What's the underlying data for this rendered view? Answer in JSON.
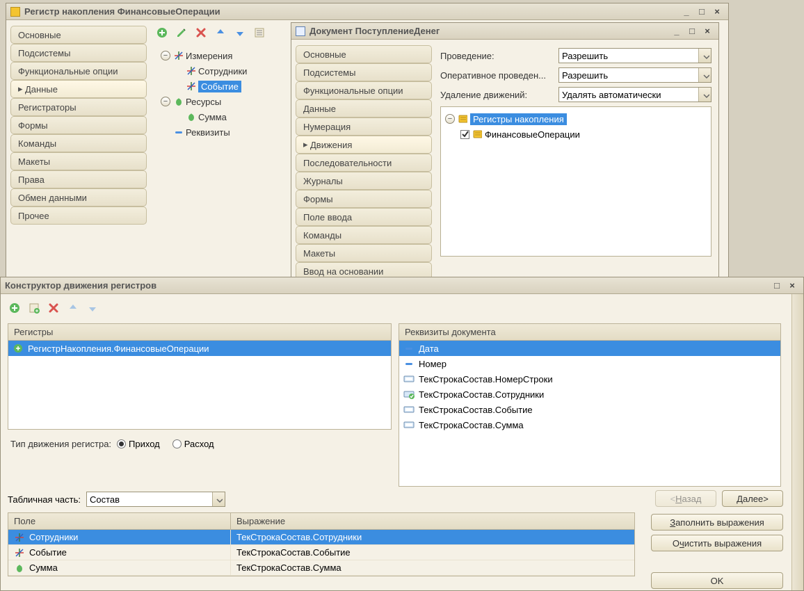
{
  "win1": {
    "title": "Регистр накопления ФинансовыеОперации",
    "tabs": [
      "Основные",
      "Подсистемы",
      "Функциональные опции",
      "Данные",
      "Регистраторы",
      "Формы",
      "Команды",
      "Макеты",
      "Права",
      "Обмен данными",
      "Прочее"
    ],
    "active_tab_index": 3,
    "tree": {
      "dimensions": "Измерения",
      "dim_items": [
        "Сотрудники",
        "Событие"
      ],
      "dim_selected": "Событие",
      "resources": "Ресурсы",
      "res_items": [
        "Сумма"
      ],
      "attributes": "Реквизиты"
    }
  },
  "win2": {
    "title": "Документ ПоступлениеДенег",
    "tabs": [
      "Основные",
      "Подсистемы",
      "Функциональные опции",
      "Данные",
      "Нумерация",
      "Движения",
      "Последовательности",
      "Журналы",
      "Формы",
      "Поле ввода",
      "Команды",
      "Макеты",
      "Ввод на основании"
    ],
    "active_tab_index": 5,
    "props": {
      "label_provedenie": "Проведение:",
      "value_provedenie": "Разрешить",
      "label_oper": "Оперативное проведен...",
      "value_oper": "Разрешить",
      "label_udal": "Удаление движений:",
      "value_udal": "Удалять автоматически"
    },
    "reg_tree": {
      "root": "Регистры накопления",
      "child": "ФинансовыеОперации",
      "child_checked": true
    }
  },
  "win3": {
    "title": "Конструктор движения регистров",
    "left_header": "Регистры",
    "left_item": "РегистрНакопления.ФинансовыеОперации",
    "right_header": "Реквизиты документа",
    "right_items": [
      "Дата",
      "Номер",
      "ТекСтрокаСостав.НомерСтроки",
      "ТекСтрокаСостав.Сотрудники",
      "ТекСтрокаСостав.Событие",
      "ТекСтрокаСостав.Сумма"
    ],
    "right_selected_index": 0,
    "move_type_label": "Тип движения регистра:",
    "radio_income": "Приход",
    "radio_expense": "Расход",
    "tab_part_label": "Табличная часть:",
    "tab_part_value": "Состав",
    "btn_back": "<Назад",
    "btn_next": "Далее>",
    "btn_fill": "Заполнить выражения",
    "btn_clear": "Очистить выражения",
    "btn_ok": "OK",
    "grid_col1": "Поле",
    "grid_col2": "Выражение",
    "grid_rows": [
      {
        "field": "Сотрудники",
        "expr": "ТекСтрокаСостав.Сотрудники"
      },
      {
        "field": "Событие",
        "expr": "ТекСтрокаСостав.Событие"
      },
      {
        "field": "Сумма",
        "expr": "ТекСтрокаСостав.Сумма"
      }
    ]
  },
  "icons": {
    "dim": "axes",
    "res": "green-drop",
    "attr": "minus"
  }
}
